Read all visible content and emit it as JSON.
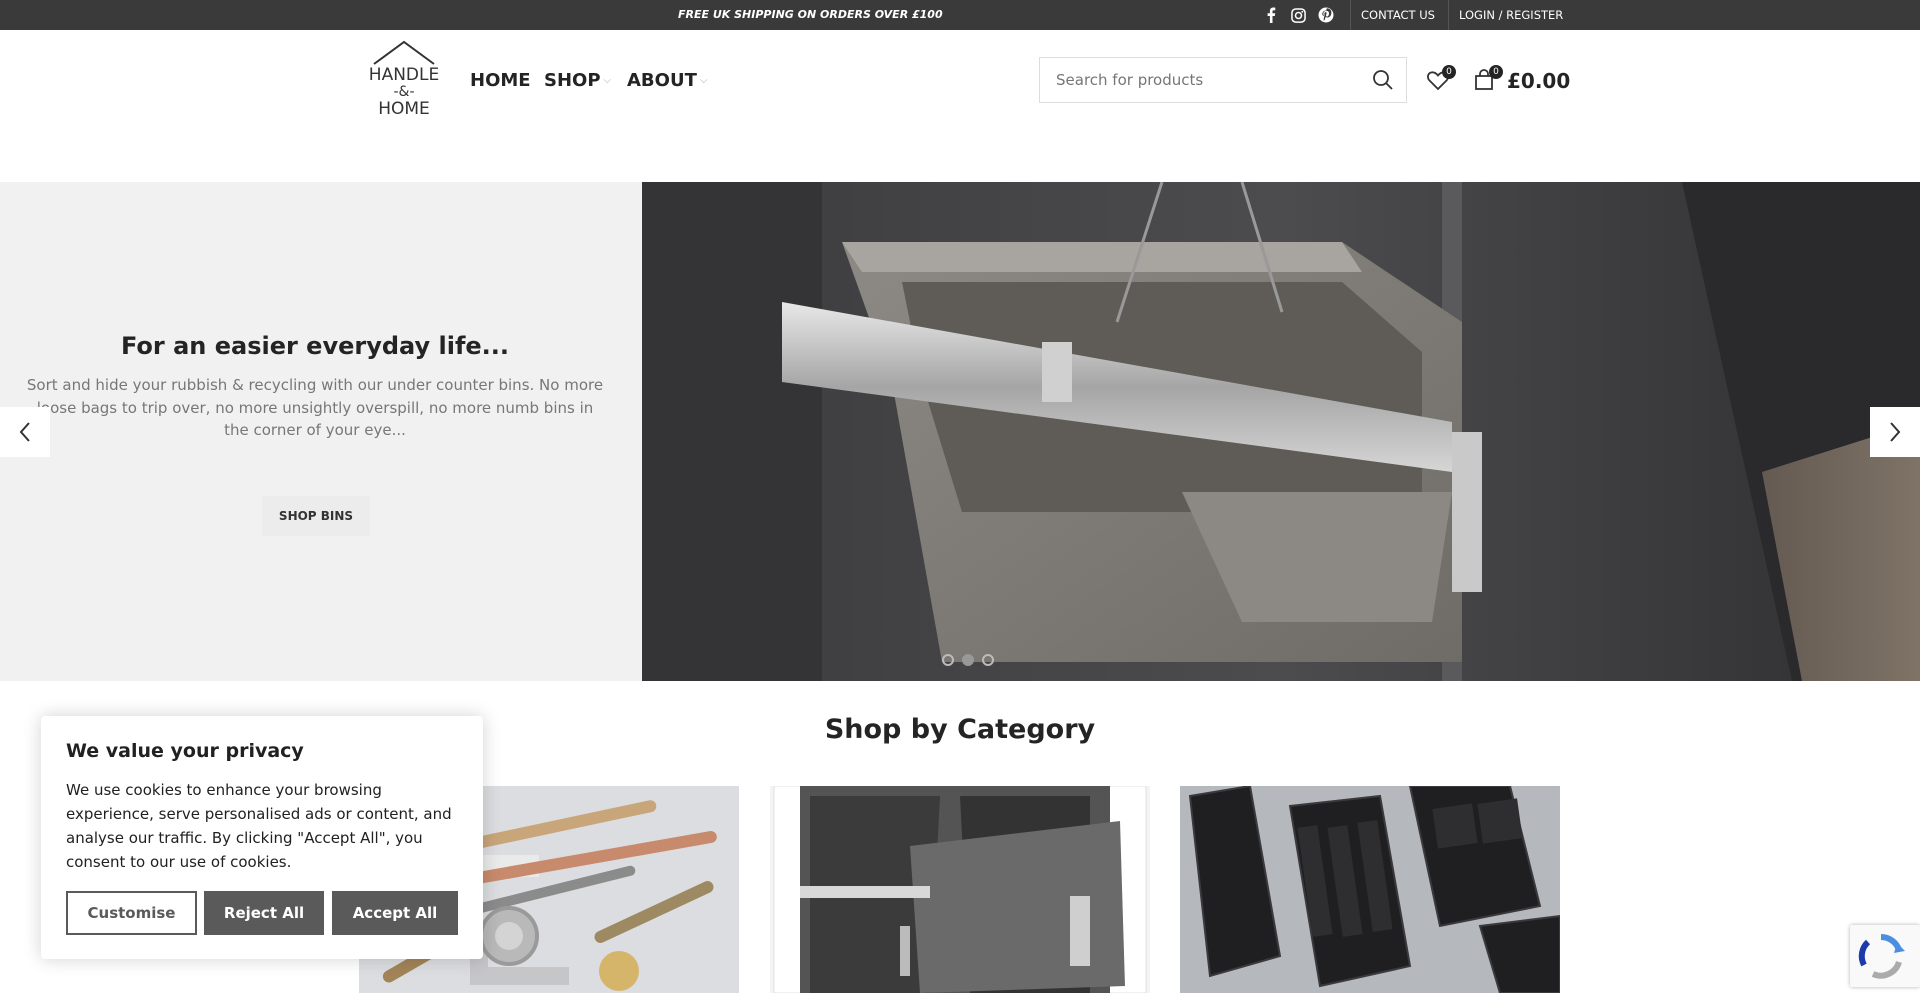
{
  "topbar": {
    "promo": "FREE UK SHIPPING ON ORDERS OVER £100",
    "social_icons": [
      "facebook-icon",
      "instagram-icon",
      "pinterest-icon"
    ],
    "contact": "CONTACT US",
    "login": "LOGIN / REGISTER"
  },
  "logo": {
    "line1": "HANDLE",
    "line2": "-&-",
    "line3": "HOME"
  },
  "nav": {
    "home": "HOME",
    "shop": "SHOP",
    "about": "ABOUT"
  },
  "search": {
    "placeholder": "Search for products"
  },
  "header": {
    "wishlist_count": "0",
    "cart_count": "0",
    "cart_total": "£0.00"
  },
  "hero": {
    "title": "For an easier everyday life...",
    "text": "Sort and hide your rubbish & recycling with our under counter bins. No more loose bags to trip over, no more unsightly overspill, no more numb bins in the corner of your eye...",
    "button": "SHOP BINS",
    "slides": 3,
    "active_slide": 2
  },
  "category": {
    "title": "Shop by Category"
  },
  "cookie": {
    "title": "We value your privacy",
    "text": "We use cookies to enhance your browsing experience, serve personalised ads or content, and analyse our traffic. By clicking \"Accept All\", you consent to our use of cookies.",
    "customise": "Customise",
    "reject": "Reject All",
    "accept": "Accept All"
  },
  "colors": {
    "topbar": "#3a3a3a",
    "cookie_button": "#5a5a5a",
    "hero_bg": "#f1f1f1"
  }
}
